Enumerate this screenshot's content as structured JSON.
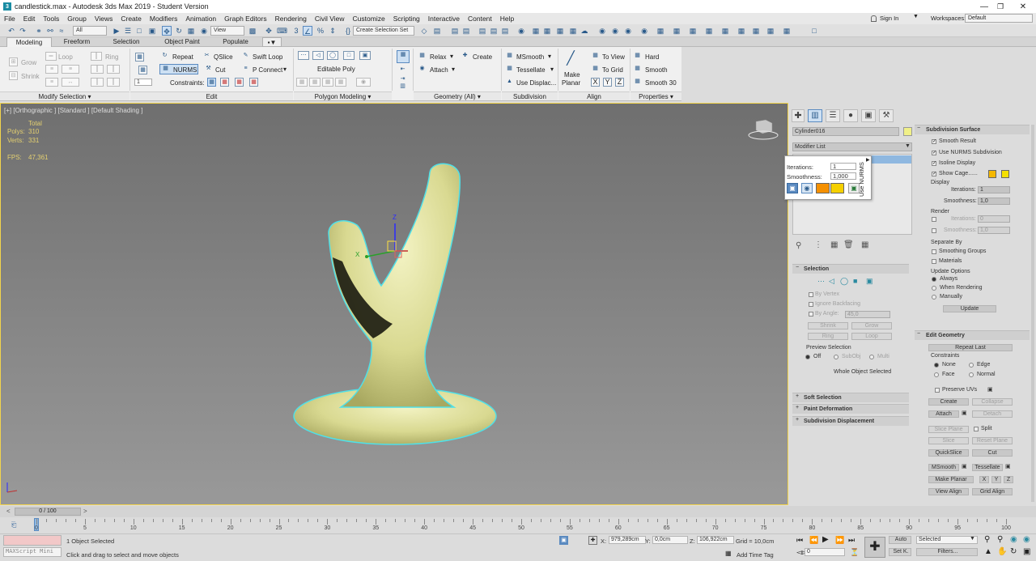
{
  "window": {
    "title": "candlestick.max - Autodesk 3ds Max 2019 - Student Version",
    "app_icon": "3"
  },
  "menu": [
    "File",
    "Edit",
    "Tools",
    "Group",
    "Views",
    "Create",
    "Modifiers",
    "Animation",
    "Graph Editors",
    "Rendering",
    "Civil View",
    "Customize",
    "Scripting",
    "Interactive",
    "Content",
    "Help"
  ],
  "account": {
    "sign_in": "Sign In",
    "workspaces_label": "Workspaces:",
    "workspace": "Default"
  },
  "toolbar": {
    "filter": "All",
    "ref_coord": "View",
    "selection_set": "Create Selection Set"
  },
  "ribbon_tabs": [
    "Modeling",
    "Freeform",
    "Selection",
    "Object Paint",
    "Populate"
  ],
  "ribbon": {
    "modify_selection": {
      "grow": "Grow",
      "shrink": "Shrink",
      "loop": "Loop",
      "ring": "Ring",
      "footer": "Modify Selection"
    },
    "edit": {
      "repeat": "Repeat",
      "qslice": "QSlice",
      "swift_loop": "Swift Loop",
      "nurms": "NURMS",
      "cut": "Cut",
      "p_connect": "P Connect",
      "constraints": "Constraints:",
      "spinner_value": "1",
      "footer": "Edit"
    },
    "polygon_modeling": {
      "editable_poly": "Editable Poly",
      "footer": "Polygon Modeling"
    },
    "geometry": {
      "relax": "Relax",
      "create": "Create",
      "attach": "Attach",
      "footer": "Geometry (All)"
    },
    "subdivision": {
      "msmooth": "MSmooth",
      "tessellate": "Tessellate",
      "use_displace": "Use Displac...",
      "footer": "Subdivision"
    },
    "align": {
      "make_planar_1": "Make",
      "make_planar_2": "Planar",
      "to_view": "To View",
      "to_grid": "To Grid",
      "x": "X",
      "y": "Y",
      "z": "Z",
      "footer": "Align"
    },
    "properties": {
      "hard": "Hard",
      "smooth": "Smooth",
      "smooth30": "Smooth 30",
      "footer": "Properties"
    }
  },
  "viewport": {
    "label": "[+] [Orthographic ] [Standard ] [Default Shading ]",
    "stats": {
      "total": "Total",
      "polys_label": "Polys:",
      "polys": "310",
      "verts_label": "Verts:",
      "verts": "331",
      "fps_label": "FPS:",
      "fps": "47,361"
    },
    "gizmo": {
      "x": "X",
      "z": "Z"
    }
  },
  "caddy": {
    "iterations_label": "Iterations:",
    "iterations": "1",
    "smoothness_label": "Smoothness:",
    "smoothness": "1,000",
    "title": "Use NURMS"
  },
  "panel": {
    "object_name": "Cylinder016",
    "modifier_list": "Modifier List",
    "selection": {
      "header": "Selection",
      "by_vertex": "By Vertex",
      "ignore_backfacing": "Ignore Backfacing",
      "by_angle": "By Angle:",
      "by_angle_value": "45,0",
      "shrink": "Shrink",
      "grow": "Grow",
      "ring": "Ring",
      "loop": "Loop",
      "preview_selection": "Preview Selection",
      "off": "Off",
      "subobj": "SubObj",
      "multi": "Multi",
      "status": "Whole Object Selected"
    },
    "rollouts": [
      "Soft Selection",
      "Paint Deformation",
      "Subdivision Displacement"
    ],
    "subdivision_surface": {
      "header": "Subdivision Surface",
      "smooth_result": "Smooth Result",
      "use_nurms": "Use NURMS Subdivision",
      "isoline": "Isoline Display",
      "show_cage": "Show Cage......",
      "display": "Display",
      "iterations_label": "Iterations:",
      "iterations": "1",
      "smoothness_label": "Smoothness:",
      "smoothness": "1,0",
      "render": "Render",
      "r_iterations": "0",
      "r_smoothness": "1,0",
      "separate_by": "Separate By",
      "smoothing_groups": "Smoothing Groups",
      "materials": "Materials",
      "update_options": "Update Options",
      "always": "Always",
      "when_rendering": "When Rendering",
      "manually": "Manually",
      "update": "Update"
    },
    "edit_geometry": {
      "header": "Edit Geometry",
      "repeat_last": "Repeat Last",
      "constraints": "Constraints",
      "none": "None",
      "edge": "Edge",
      "face": "Face",
      "normal": "Normal",
      "preserve_uvs": "Preserve UVs",
      "create": "Create",
      "collapse": "Collapse",
      "attach": "Attach",
      "detach": "Detach",
      "slice_plane": "Slice Plane",
      "split": "Split",
      "slice": "Slice",
      "reset_plane": "Reset Plane",
      "quickslice": "QuickSlice",
      "cut": "Cut",
      "msmooth": "MSmooth",
      "tessellate": "Tessellate",
      "make_planar": "Make Planar",
      "x": "X",
      "y": "Y",
      "z": "Z",
      "view_align": "View Align",
      "grid_align": "Grid Align"
    }
  },
  "timeline": {
    "frame": "0 / 100",
    "ticks": [
      "0",
      "5",
      "10",
      "15",
      "20",
      "25",
      "30",
      "35",
      "40",
      "45",
      "50",
      "55",
      "60",
      "65",
      "70",
      "75",
      "80",
      "85",
      "90",
      "95",
      "100"
    ]
  },
  "status": {
    "maxscript": "MAXScript Mini",
    "selected": "1 Object Selected",
    "prompt": "Click and drag to select and move objects",
    "x_label": "X:",
    "x": "979,289cm",
    "y_label": "Y:",
    "y": "0,0cm",
    "z_label": "Z:",
    "z": "106,922cm",
    "grid": "Grid = 10,0cm",
    "add_time_tag": "Add Time Tag",
    "frame": "0",
    "auto": "Auto",
    "selected_dd": "Selected",
    "set_key": "Set K.",
    "filters": "Filters..."
  }
}
